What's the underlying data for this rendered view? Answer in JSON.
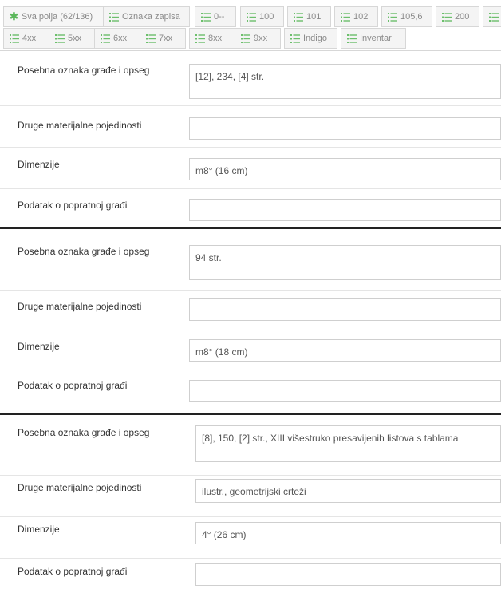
{
  "tabs": [
    {
      "label": "Sva polja (62/136)",
      "icon": "asterisk-icon"
    },
    {
      "label": "Oznaka zapisa",
      "icon": "list-icon"
    },
    {
      "label": "0--",
      "icon": "list-icon"
    },
    {
      "label": "100",
      "icon": "list-icon"
    },
    {
      "label": "101",
      "icon": "list-icon"
    },
    {
      "label": "102",
      "icon": "list-icon"
    },
    {
      "label": "105,6",
      "icon": "list-icon"
    },
    {
      "label": "200",
      "icon": "list-icon"
    },
    {
      "label": "",
      "icon": "list-icon"
    },
    {
      "label": "4xx",
      "icon": "list-icon"
    },
    {
      "label": "5xx",
      "icon": "list-icon"
    },
    {
      "label": "6xx",
      "icon": "list-icon"
    },
    {
      "label": "7xx",
      "icon": "list-icon"
    },
    {
      "label": "8xx",
      "icon": "list-icon"
    },
    {
      "label": "9xx",
      "icon": "list-icon"
    },
    {
      "label": "Indigo",
      "icon": "list-icon"
    },
    {
      "label": "Inventar",
      "icon": "list-icon"
    }
  ],
  "records": [
    {
      "extent_label": "Posebna oznaka građe i opseg",
      "extent_value": "[12], 234, [4] str.",
      "other_label": "Druge materijalne pojedinosti",
      "other_value": "",
      "dim_label": "Dimenzije",
      "dim_value": "m8° (16 cm)",
      "acc_label": "Podatak o popratnoj građi",
      "acc_value": ""
    },
    {
      "extent_label": "Posebna oznaka građe i opseg",
      "extent_value": "94 str.",
      "other_label": "Druge materijalne pojedinosti",
      "other_value": "",
      "dim_label": "Dimenzije",
      "dim_value": "m8° (18 cm)",
      "acc_label": "Podatak o popratnoj građi",
      "acc_value": ""
    },
    {
      "extent_label": "Posebna oznaka građe i opseg",
      "extent_value": "[8], 150, [2] str., XIII višestruko presavijenih listova s tablama",
      "other_label": "Druge materijalne pojedinosti",
      "other_value": "ilustr., geometrijski crteži",
      "dim_label": "Dimenzije",
      "dim_value": "4° (26 cm)",
      "acc_label": "Podatak o popratnoj građi",
      "acc_value": ""
    }
  ],
  "colors": {
    "accent_green": "#5cb85c",
    "icon_green": "#6cbf6c"
  }
}
